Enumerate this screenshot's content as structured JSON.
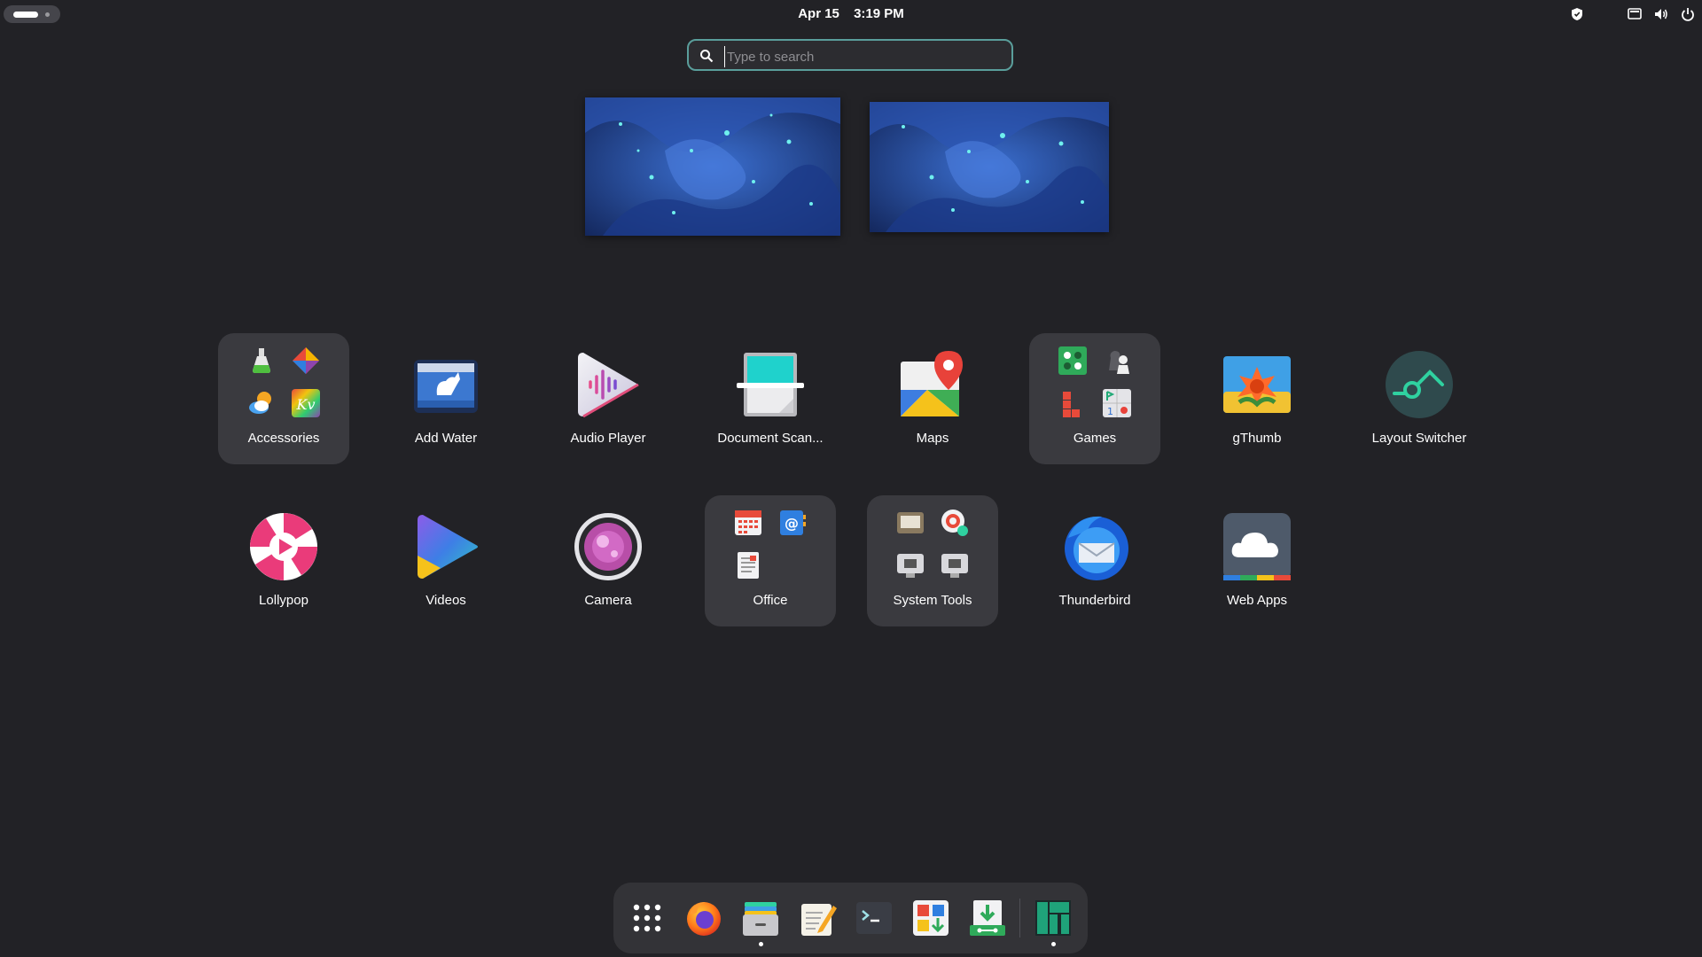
{
  "topbar": {
    "date": "Apr 15",
    "time": "3:19 PM",
    "tray_icons": [
      "shield-icon",
      "screen-icon",
      "volume-icon",
      "power-icon"
    ]
  },
  "search": {
    "placeholder": "Type to search"
  },
  "workspaces": [
    "workspace-1",
    "workspace-2"
  ],
  "apps": [
    {
      "label": "Accessories",
      "folder": true
    },
    {
      "label": "Add Water",
      "folder": false
    },
    {
      "label": "Audio Player",
      "folder": false
    },
    {
      "label": "Document Scan...",
      "folder": false
    },
    {
      "label": "Maps",
      "folder": false
    },
    {
      "label": "Games",
      "folder": true
    },
    {
      "label": "gThumb",
      "folder": false
    },
    {
      "label": "Layout Switcher",
      "folder": false
    },
    {
      "label": "Lollypop",
      "folder": false
    },
    {
      "label": "Videos",
      "folder": false
    },
    {
      "label": "Camera",
      "folder": false
    },
    {
      "label": "Office",
      "folder": true
    },
    {
      "label": "System Tools",
      "folder": true
    },
    {
      "label": "Thunderbird",
      "folder": false
    },
    {
      "label": "Web Apps",
      "folder": false
    }
  ],
  "dock": [
    {
      "name": "app-grid",
      "running": false
    },
    {
      "name": "firefox",
      "running": false
    },
    {
      "name": "files",
      "running": true
    },
    {
      "name": "text-editor",
      "running": false
    },
    {
      "name": "terminal",
      "running": false
    },
    {
      "name": "software",
      "running": false
    },
    {
      "name": "installer",
      "running": false
    },
    {
      "name": "manjaro-settings",
      "running": true
    }
  ],
  "colors": {
    "background": "#222226",
    "accent": "#5a9e9b",
    "folder": "#3a3a3f",
    "dock": "#333337"
  }
}
